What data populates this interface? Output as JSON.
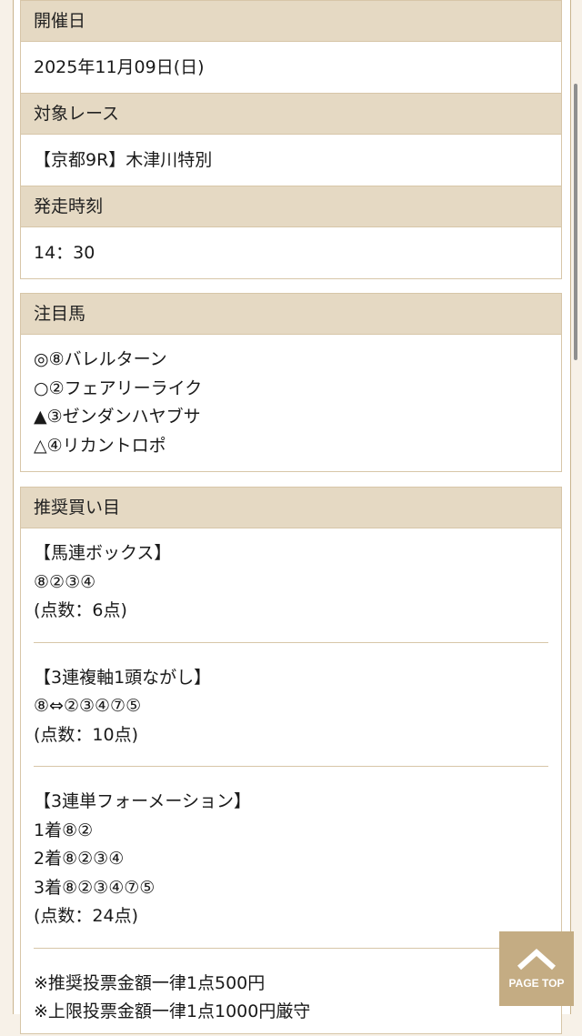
{
  "race_info": {
    "date_label": "開催日",
    "date_value": "2025年11月09日(日)",
    "race_label": "対象レース",
    "race_value": "【京都9R】木津川特別",
    "time_label": "発走時刻",
    "time_value": "14：30"
  },
  "horses": {
    "label": "注目馬",
    "items": [
      "◎⑧バレルターン",
      "○②フェアリーライク",
      "▲③ゼンダンハヤブサ",
      "△④リカントロポ"
    ]
  },
  "bets": {
    "label": "推奨買い目",
    "sections": [
      {
        "lines": [
          "【馬連ボックス】",
          "⑧②③④",
          "(点数：6点)"
        ]
      },
      {
        "lines": [
          "【3連複軸1頭ながし】",
          "⑧⇔②③④⑦⑤",
          "(点数：10点)"
        ]
      },
      {
        "lines": [
          "【3連単フォーメーション】",
          "1着⑧②",
          "2着⑧②③④",
          "3着⑧②③④⑦⑤",
          "(点数：24点)"
        ]
      },
      {
        "lines": [
          "※推奨投票金額一律1点500円",
          "※上限投票金額一律1点1000円厳守"
        ]
      }
    ]
  },
  "page_top": {
    "label": "PAGE TOP",
    "icon": "chevron-up-icon"
  },
  "colors": {
    "header_bg": "#e5d9c3",
    "border": "#d7c6a8",
    "page_top_bg": "#c4ac83"
  }
}
